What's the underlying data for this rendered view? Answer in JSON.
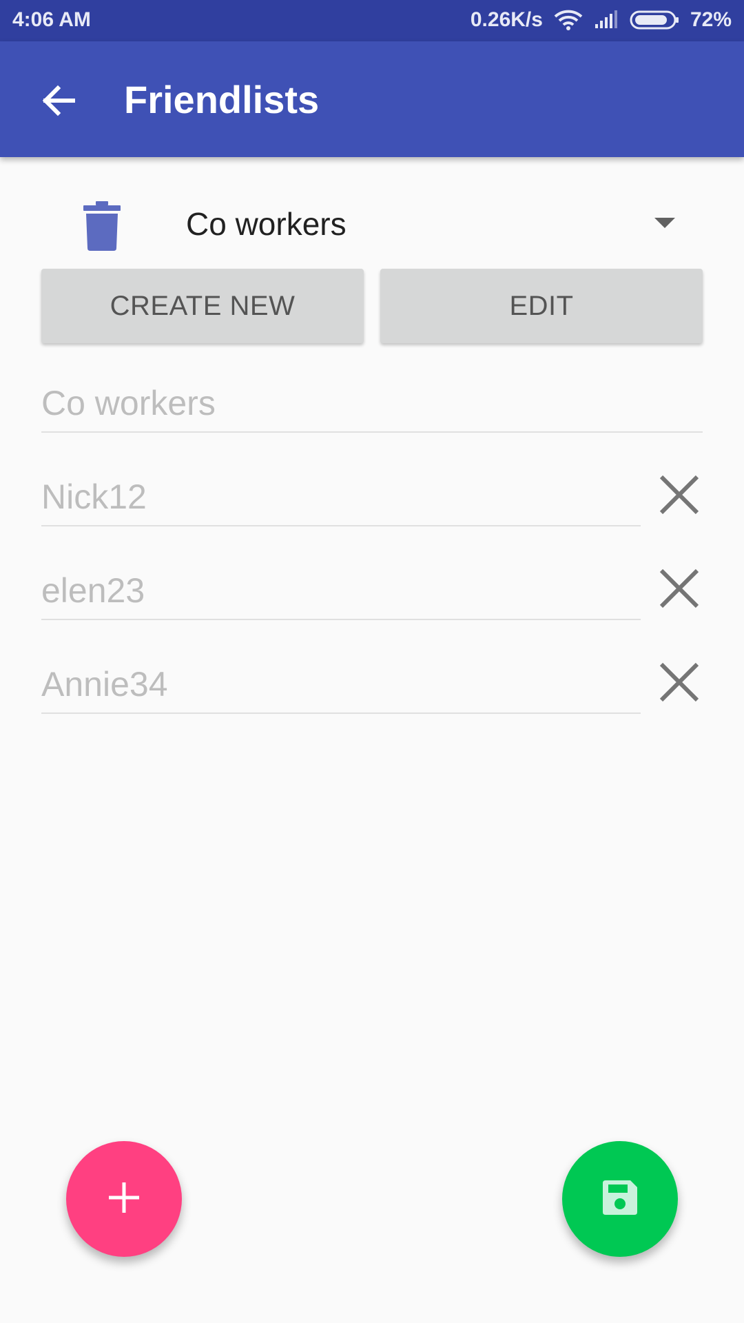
{
  "status_bar": {
    "time": "4:06 AM",
    "network_speed": "0.26K/s",
    "battery": "72%",
    "icons": [
      "wifi-icon",
      "signal-icon",
      "battery-icon"
    ]
  },
  "app_bar": {
    "title": "Friendlists",
    "back_icon": "arrow-left-icon",
    "color": "#3f51b5"
  },
  "selector": {
    "selected_list": "Co workers",
    "delete_icon": "trash-icon"
  },
  "buttons": {
    "create_new": "CREATE NEW",
    "edit": "EDIT"
  },
  "form": {
    "list_name_placeholder": "Co workers",
    "members": [
      {
        "placeholder": "Nick12"
      },
      {
        "placeholder": "elen23"
      },
      {
        "placeholder": "Annie34"
      }
    ],
    "remove_icon": "close-icon"
  },
  "fabs": {
    "add": {
      "icon": "plus-icon",
      "color": "#ff4081"
    },
    "save": {
      "icon": "save-icon",
      "color": "#00c853"
    }
  }
}
